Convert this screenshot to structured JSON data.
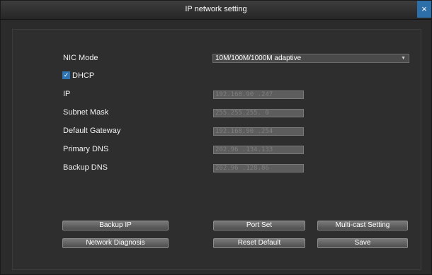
{
  "window": {
    "title": "IP network setting",
    "close_icon": "×"
  },
  "form": {
    "nic_mode_label": "NIC Mode",
    "nic_mode_value": "10M/100M/1000M  adaptive",
    "dhcp_label": "DHCP",
    "dhcp_checked": true,
    "ip_label": "IP",
    "ip_value": "192.168.90 .247",
    "subnet_label": "Subnet Mask",
    "subnet_value": "255.255.255. 0",
    "gateway_label": "Default Gateway",
    "gateway_value": "192.168.90 .254",
    "primary_dns_label": "Primary DNS",
    "primary_dns_value": "202.96 .134.133",
    "backup_dns_label": "Backup DNS",
    "backup_dns_value": "202.96 .128.86"
  },
  "buttons": {
    "backup_ip": "Backup IP",
    "port_set": "Port Set",
    "multicast": "Multi-cast Setting",
    "network_diagnosis": "Network Diagnosis",
    "reset_default": "Reset Default",
    "save": "Save"
  },
  "colors": {
    "title_bar": "#2b2b2b",
    "accent": "#2f74b3",
    "close_button": "#2d6fa8"
  },
  "icons": {
    "close": "close-icon",
    "dropdown": "chevron-down-icon",
    "check": "check-icon"
  }
}
